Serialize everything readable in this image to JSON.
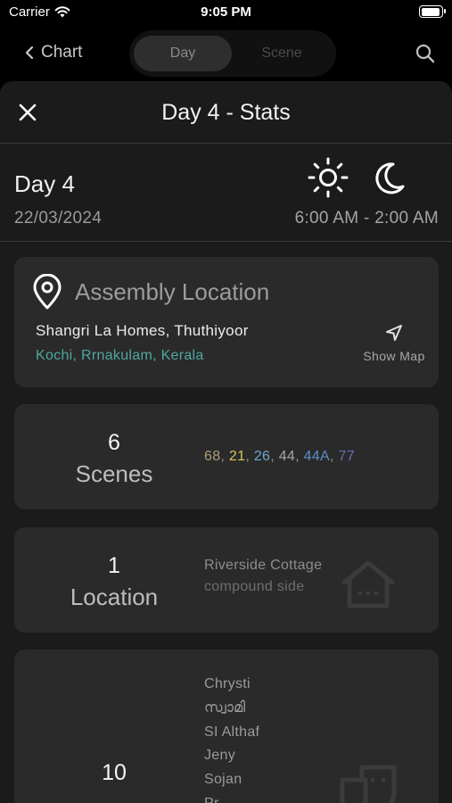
{
  "status": {
    "carrier": "Carrier",
    "time": "9:05 PM"
  },
  "nav": {
    "back_label": "Chart",
    "tabs": [
      "Day",
      "Scene"
    ]
  },
  "sheet": {
    "title": "Day 4 - Stats"
  },
  "day": {
    "label": "Day 4",
    "date": "22/03/2024",
    "time_range": "6:00 AM - 2:00 AM"
  },
  "assembly": {
    "title": "Assembly Location",
    "address": "Shangri La Homes, Thuthiyoor",
    "city": "Kochi, Rrnakulam, Kerala",
    "show_map": "Show Map"
  },
  "scenes": {
    "count": "6",
    "label": "Scenes",
    "items": [
      {
        "text": "68",
        "color": "#b09a78"
      },
      {
        "text": "21",
        "color": "#d8c55a"
      },
      {
        "text": "26",
        "color": "#6fa4c9"
      },
      {
        "text": "44",
        "color": "#a8a8a8"
      },
      {
        "text": "44A",
        "color": "#5b8fc8"
      },
      {
        "text": "77",
        "color": "#6a6fb0"
      }
    ],
    "separator": ", "
  },
  "locations": {
    "count": "1",
    "label": "Location",
    "name": "Riverside Cottage",
    "sub": "compound side"
  },
  "cast": {
    "count": "10",
    "names": [
      "Chrysti",
      "സ്വാമി",
      "SI Althaf",
      "Jeny",
      "Sojan",
      "Pr..."
    ]
  },
  "icons": {
    "wifi": "wifi-icon",
    "battery": "battery-icon",
    "back": "chevron-left-icon",
    "search": "search-icon",
    "close": "close-icon",
    "sun": "sun-icon",
    "moon": "moon-icon",
    "pin": "map-pin-icon",
    "navigate": "navigation-arrow-icon",
    "house": "house-icon",
    "masks": "theater-masks-icon"
  }
}
